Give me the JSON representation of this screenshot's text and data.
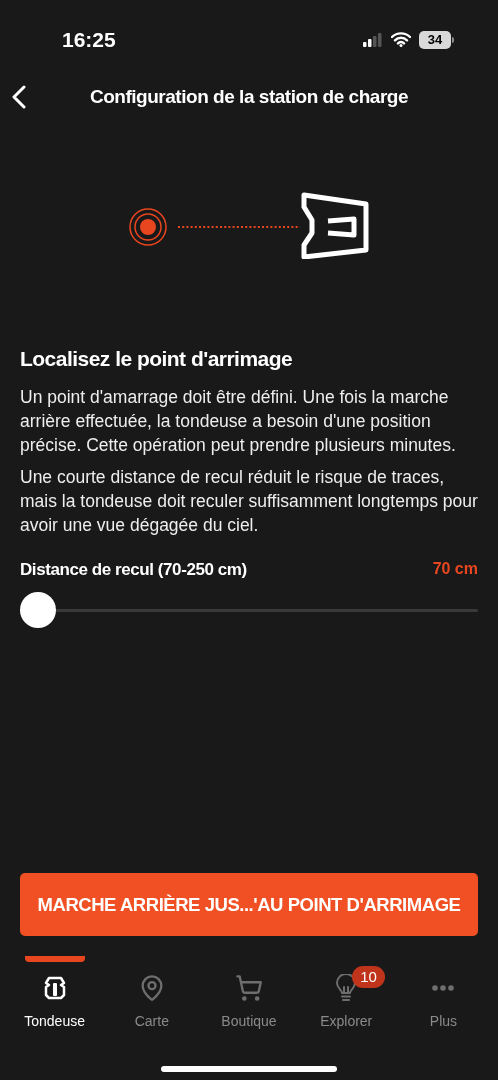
{
  "status_bar": {
    "time": "16:25",
    "battery": "34"
  },
  "header": {
    "title": "Configuration de la station de charge"
  },
  "section": {
    "title": "Localisez le point d'arrimage",
    "paragraphs": [
      "Un point d'amarrage doit être défini. Une fois la marche arrière effectuée, la tondeuse a besoin d'une position précise. Cette opération peut prendre plusieurs minutes.",
      "Une courte distance de recul réduit le risque de traces, mais la tondeuse doit reculer suffisamment longtemps pour avoir une vue dégagée du ciel."
    ]
  },
  "slider": {
    "label": "Distance de recul (70-250 cm)",
    "reading": "70 cm",
    "level": 0
  },
  "action_button": {
    "label": "MARCHE ARRIÈRE JUS...'AU POINT D'ARRIMAGE"
  },
  "tabs": [
    {
      "label": "Tondeuse",
      "kind": "mower",
      "selected": true
    },
    {
      "label": "Carte",
      "kind": "map",
      "selected": false
    },
    {
      "label": "Boutique",
      "kind": "cart",
      "selected": false
    },
    {
      "label": "Explorer",
      "kind": "bulb",
      "selected": false,
      "badge": "10"
    },
    {
      "label": "Plus",
      "kind": "more",
      "selected": false
    }
  ]
}
